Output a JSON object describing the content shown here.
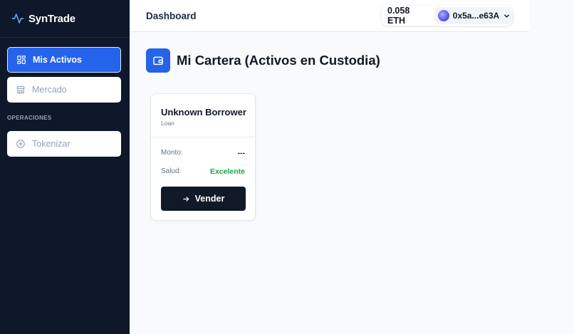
{
  "app": {
    "name": "SynTrade"
  },
  "sidebar": {
    "items": [
      {
        "label": "Mis Activos",
        "icon": "grid-icon",
        "active": true
      },
      {
        "label": "Mercado",
        "icon": "store-icon",
        "active": false
      }
    ],
    "section_label": "OPERACIONES",
    "operations": [
      {
        "label": "Tokenizar",
        "icon": "plus-circle-icon",
        "active": false
      }
    ]
  },
  "header": {
    "title": "Dashboard",
    "wallet": {
      "balance": "0.058 ETH",
      "address": "0x5a...e63A"
    }
  },
  "main": {
    "title": "Mi Cartera (Activos en Custodia)",
    "assets": [
      {
        "name": "Unknown Borrower",
        "type": "Loan",
        "amount_label": "Monto:",
        "amount_value": "---",
        "health_label": "Salud:",
        "health_value": "Excelente",
        "action_label": "Vender"
      }
    ]
  },
  "colors": {
    "sidebar_bg": "#0f172a",
    "accent": "#2563eb",
    "health_good": "#16a34a",
    "button_dark": "#111827"
  }
}
